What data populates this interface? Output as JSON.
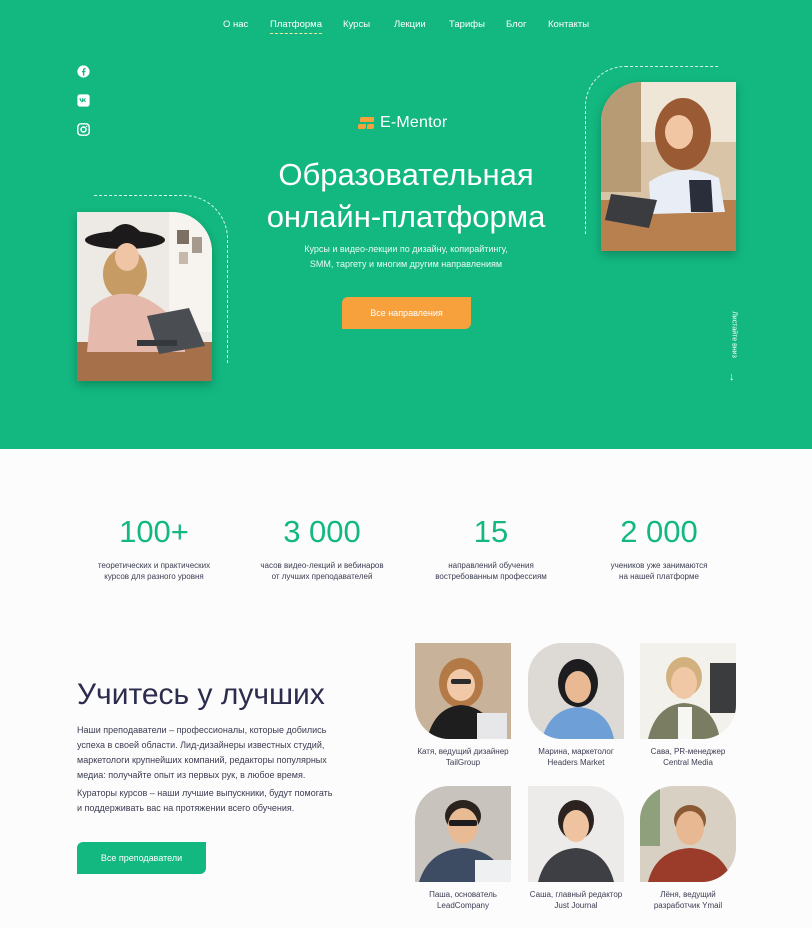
{
  "nav": {
    "items": [
      {
        "label": "О нас"
      },
      {
        "label": "Платформа",
        "active": true
      },
      {
        "label": "Курсы"
      },
      {
        "label": "Лекции"
      },
      {
        "label": "Тарифы"
      },
      {
        "label": "Блог"
      },
      {
        "label": "Контакты"
      }
    ]
  },
  "social": [
    "facebook-icon",
    "vk-icon",
    "instagram-icon"
  ],
  "brand": {
    "name": "E-Mentor"
  },
  "hero": {
    "title_line1": "Образовательная",
    "title_line2": "онлайн-платформа",
    "subtitle_line1": "Курсы и видео-лекции по дизайну, копирайтингу,",
    "subtitle_line2": "SMM, таргету и многим другим направлениям",
    "cta": "Все направления",
    "scroll_hint": "Листайте вниз"
  },
  "stats": [
    {
      "value": "100+",
      "label_line1": "теоретических и практических",
      "label_line2": "курсов для разного уровня"
    },
    {
      "value": "3 000",
      "label_line1": "часов видео-лекций и вебинаров",
      "label_line2": "от лучших преподавателей"
    },
    {
      "value": "15",
      "label_line1": "направлений обучения",
      "label_line2": "востребованным профессиям"
    },
    {
      "value": "2 000",
      "label_line1": "учеников уже занимаются",
      "label_line2": "на нашей платформе"
    }
  ],
  "teachers_section": {
    "title": "Учитесь у лучших",
    "p1_l1": "Наши преподаватели – профессионалы, которые добились",
    "p1_l2": "успеха в своей области. Лид-дизайнеры известных студий,",
    "p1_l3": "маркетологи крупнейших компаний, редакторы популярных",
    "p1_l4": "медиа: получайте опыт из первых рук, в любое время.",
    "p2_l1": "Кураторы курсов – наши лучшие выпускники, будут помогать",
    "p2_l2": "и поддерживать вас на протяжении всего обучения.",
    "cta": "Все преподаватели"
  },
  "teachers": [
    {
      "line1": "Катя, ведущий дизайнер",
      "line2": "TailGroup"
    },
    {
      "line1": "Марина, маркетолог",
      "line2": "Headers Market"
    },
    {
      "line1": "Сава, PR-менеджер",
      "line2": "Central Media"
    },
    {
      "line1": "Паша, основатель",
      "line2": "LeadCompany"
    },
    {
      "line1": "Саша, главный редактор",
      "line2": "Just Journal"
    },
    {
      "line1": "Лёня, ведущий",
      "line2": "разработчик Ymail"
    }
  ],
  "colors": {
    "brand_green": "#13b880",
    "accent_orange": "#f7a13d",
    "heading_dark": "#2b2c4e"
  }
}
